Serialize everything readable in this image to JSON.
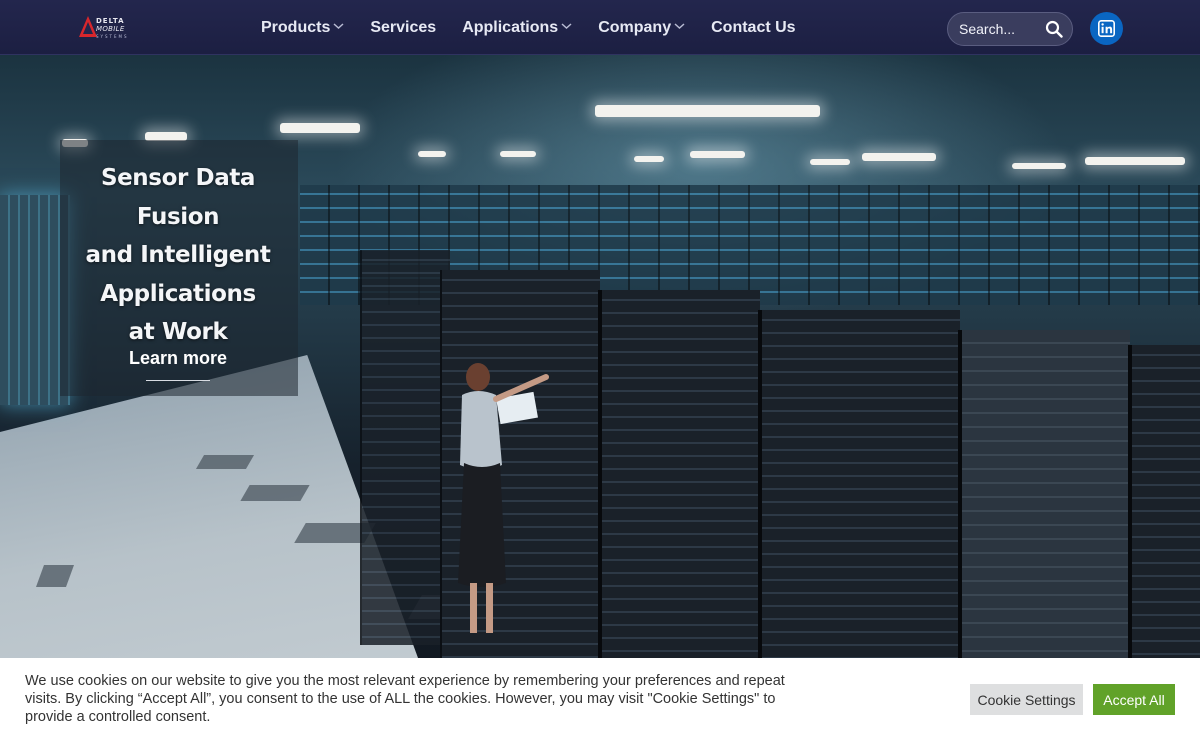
{
  "colors": {
    "header_bg": "#23264d",
    "nav_text": "#e7e9f4",
    "linkedin_bg": "#0a66c2",
    "accept_bg": "#61a229",
    "settings_bg": "#dedfe0"
  },
  "header": {
    "logo": {
      "line1": "DELTA",
      "line2": "MOBILE",
      "line3": "SYSTEMS",
      "icon": "delta-triangle-icon"
    },
    "nav": [
      {
        "label": "Products",
        "has_dropdown": true
      },
      {
        "label": "Services",
        "has_dropdown": false
      },
      {
        "label": "Applications",
        "has_dropdown": true
      },
      {
        "label": "Company",
        "has_dropdown": true
      },
      {
        "label": "Contact Us",
        "has_dropdown": false
      }
    ],
    "search": {
      "placeholder": "Search...",
      "icon": "search-icon"
    },
    "social": {
      "icon": "linkedin-icon"
    }
  },
  "hero": {
    "title_lines": [
      "Sensor Data Fusion",
      "and Intelligent",
      "Applications",
      "at Work"
    ],
    "cta_label": "Learn more"
  },
  "cookie": {
    "text": "We use cookies on our website to give you the most relevant experience by remembering your preferences and repeat visits. By clicking “Accept All”, you consent to the use of ALL the cookies. However, you may visit \"Cookie Settings\" to provide a controlled consent.",
    "settings_label": "Cookie Settings",
    "accept_label": "Accept All"
  }
}
